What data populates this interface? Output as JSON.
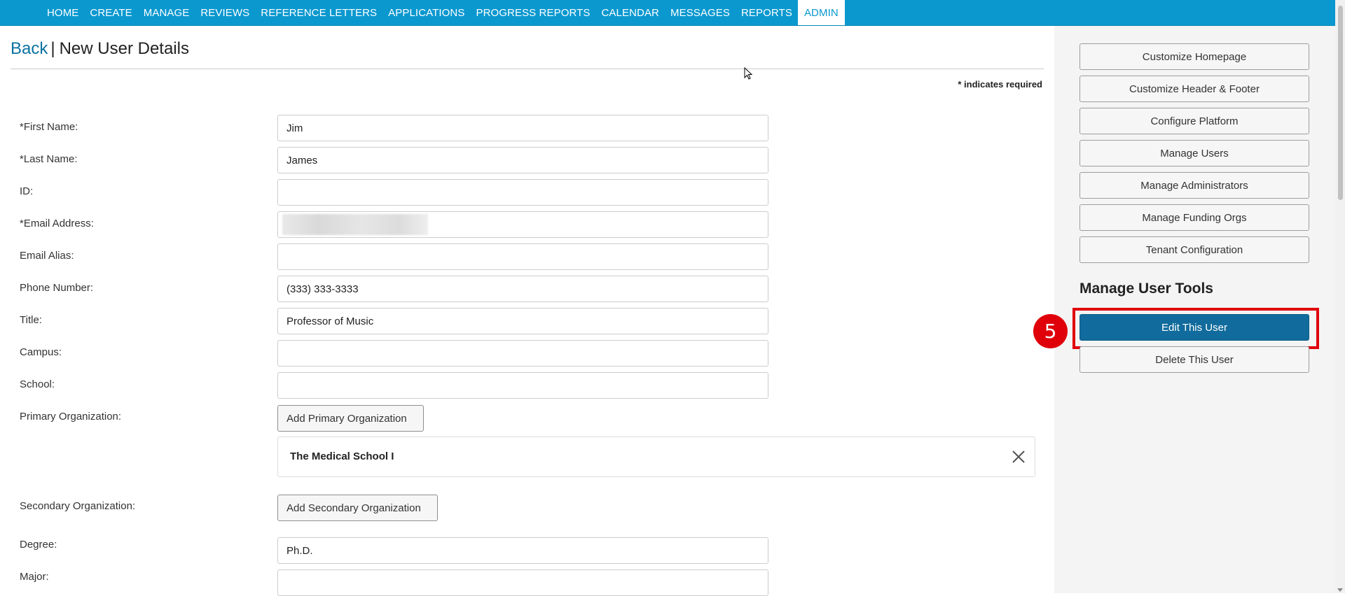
{
  "nav": {
    "items": [
      {
        "label": "HOME",
        "active": false
      },
      {
        "label": "CREATE",
        "active": false
      },
      {
        "label": "MANAGE",
        "active": false
      },
      {
        "label": "REVIEWS",
        "active": false
      },
      {
        "label": "REFERENCE LETTERS",
        "active": false
      },
      {
        "label": "APPLICATIONS",
        "active": false
      },
      {
        "label": "PROGRESS REPORTS",
        "active": false
      },
      {
        "label": "CALENDAR",
        "active": false
      },
      {
        "label": "MESSAGES",
        "active": false
      },
      {
        "label": "REPORTS",
        "active": false
      },
      {
        "label": "ADMIN",
        "active": true
      }
    ]
  },
  "header": {
    "back_label": "Back",
    "separator": "|",
    "title": "New User Details"
  },
  "form": {
    "required_note": "* indicates required",
    "fields": {
      "first_name": {
        "label": "*First Name:",
        "value": "Jim"
      },
      "last_name": {
        "label": "*Last Name:",
        "value": "James"
      },
      "id": {
        "label": "ID:",
        "value": ""
      },
      "email": {
        "label": "*Email Address:",
        "value": ""
      },
      "email_alias": {
        "label": "Email Alias:",
        "value": ""
      },
      "phone": {
        "label": "Phone Number:",
        "value": "(333) 333-3333"
      },
      "title": {
        "label": "Title:",
        "value": "Professor of Music"
      },
      "campus": {
        "label": "Campus:",
        "value": ""
      },
      "school": {
        "label": "School:",
        "value": ""
      },
      "primary_org": {
        "label": "Primary Organization:",
        "button_label": "Add Primary Organization",
        "selected": "The Medical School I"
      },
      "secondary_org": {
        "label": "Secondary Organization:",
        "button_label": "Add Secondary Organization"
      },
      "degree": {
        "label": "Degree:",
        "value": "Ph.D."
      },
      "major": {
        "label": "Major:",
        "value": ""
      }
    }
  },
  "sidebar": {
    "buttons": [
      "Customize Homepage",
      "Customize Header & Footer",
      "Configure Platform",
      "Manage Users",
      "Manage Administrators",
      "Manage Funding Orgs",
      "Tenant Configuration"
    ],
    "tools_heading": "Manage User Tools",
    "edit_label": "Edit This User",
    "delete_label": "Delete This User",
    "step_number": "5"
  },
  "colors": {
    "nav_bg": "#0b98cf",
    "primary_button": "#116b9c",
    "highlight": "#e0000a",
    "link": "#0b72a3"
  }
}
